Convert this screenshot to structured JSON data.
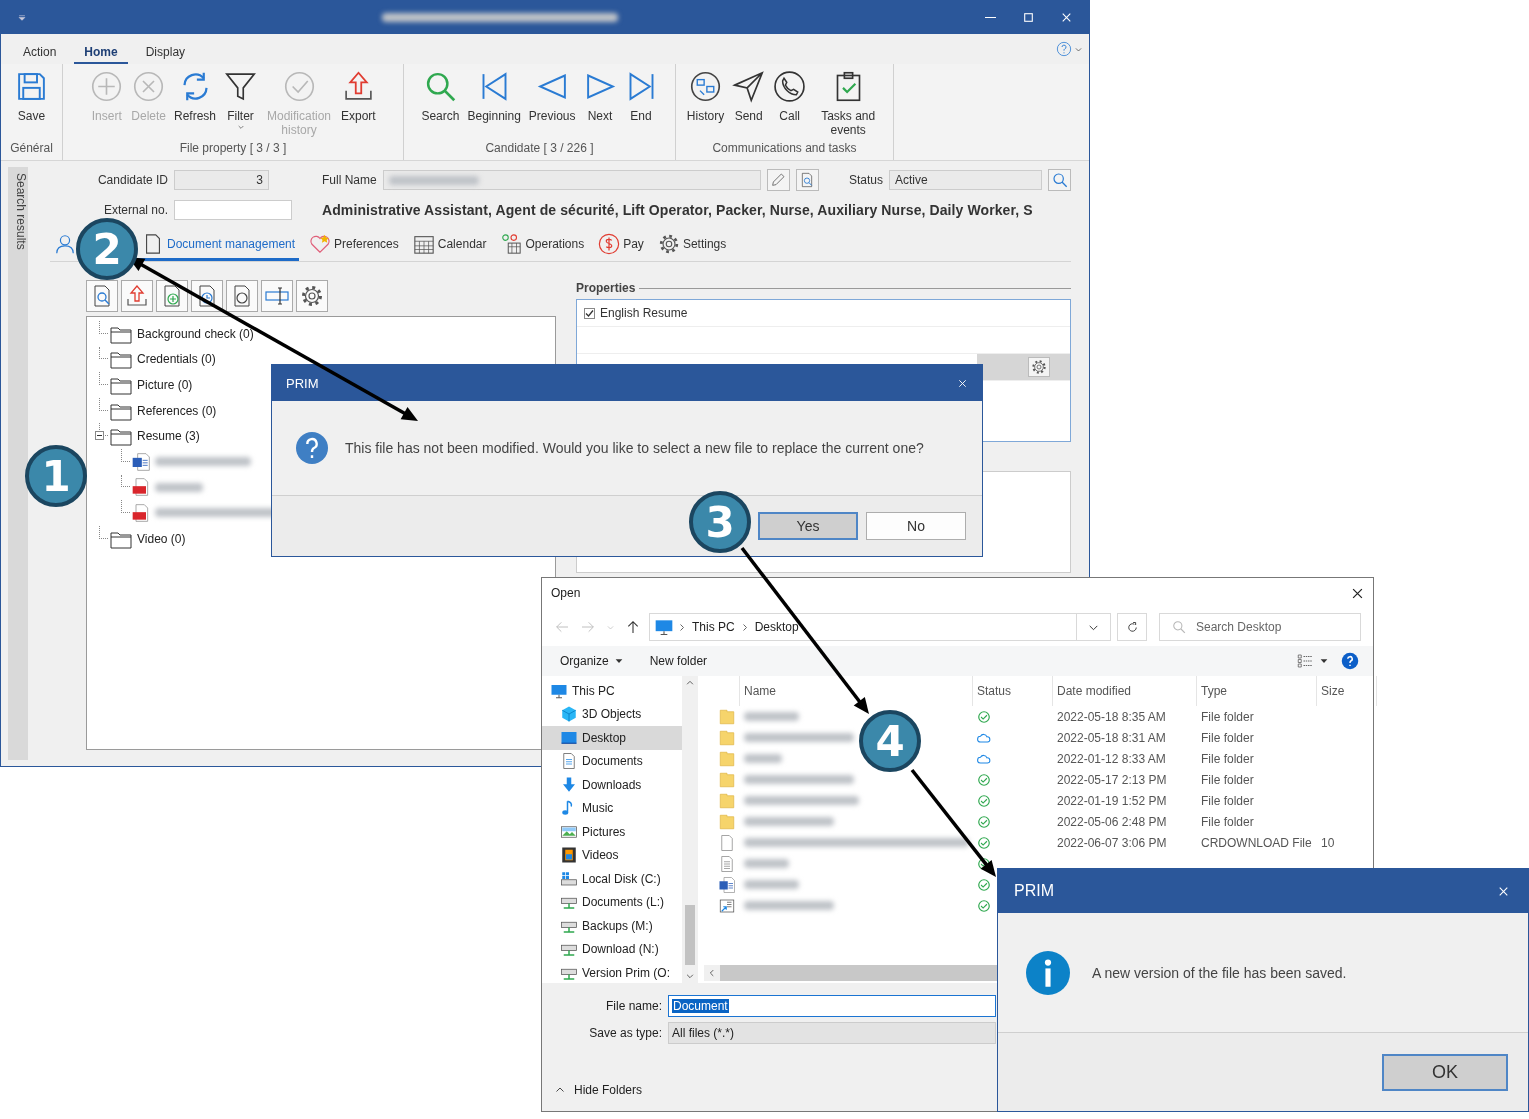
{
  "main_window": {
    "menu_tabs": [
      {
        "label": "Action",
        "selected": false
      },
      {
        "label": "Home",
        "selected": true
      },
      {
        "label": "Display",
        "selected": false
      }
    ],
    "ribbon_groups": [
      {
        "label": "Général",
        "buttons": [
          {
            "label": "Save",
            "kind": "save",
            "disabled": false,
            "dropdown": false
          }
        ]
      },
      {
        "label": "File property [ 3 / 3 ]",
        "buttons": [
          {
            "label": "Insert",
            "kind": "insert",
            "disabled": true,
            "dropdown": false
          },
          {
            "label": "Delete",
            "kind": "delete",
            "disabled": true,
            "dropdown": false
          },
          {
            "label": "Refresh",
            "kind": "refresh",
            "disabled": false,
            "dropdown": false
          },
          {
            "label": "Filter",
            "kind": "filter",
            "disabled": false,
            "dropdown": true
          },
          {
            "label": "Modification history",
            "kind": "modhistory",
            "disabled": true,
            "dropdown": false
          },
          {
            "label": "Export",
            "kind": "export",
            "disabled": false,
            "dropdown": false
          }
        ]
      },
      {
        "label": "Candidate [ 3 / 226 ]",
        "buttons": [
          {
            "label": "Search",
            "kind": "search",
            "disabled": false,
            "dropdown": false
          },
          {
            "label": "Beginning",
            "kind": "first",
            "disabled": false,
            "dropdown": false
          },
          {
            "label": "Previous",
            "kind": "previous",
            "disabled": false,
            "dropdown": false
          },
          {
            "label": "Next",
            "kind": "next",
            "disabled": false,
            "dropdown": false
          },
          {
            "label": "End",
            "kind": "end",
            "disabled": false,
            "dropdown": false
          }
        ]
      },
      {
        "label": "Communications and tasks",
        "buttons": [
          {
            "label": "History",
            "kind": "history",
            "disabled": false,
            "dropdown": false
          },
          {
            "label": "Send",
            "kind": "send",
            "disabled": false,
            "dropdown": false
          },
          {
            "label": "Call",
            "kind": "call",
            "disabled": false,
            "dropdown": false
          },
          {
            "label": "Tasks and events",
            "kind": "tasks",
            "disabled": false,
            "dropdown": false
          }
        ]
      }
    ],
    "side_tab": "Search results",
    "candidate_id": {
      "label": "Candidate ID",
      "value": "3"
    },
    "full_name": {
      "label": "Full Name"
    },
    "status": {
      "label": "Status",
      "value": "Active"
    },
    "external_no": {
      "label": "External no."
    },
    "job_titles": "Administrative Assistant, Agent de sécurité, Lift Operator, Packer, Nurse, Auxiliary Nurse, Daily Worker, S",
    "section_tabs": [
      {
        "kind": "person",
        "selected": false
      },
      {
        "label": "Document management",
        "kind": "document",
        "selected": true
      },
      {
        "label": "Preferences",
        "kind": "preferences",
        "selected": false
      },
      {
        "label": "Calendar",
        "kind": "calendar",
        "selected": false
      },
      {
        "label": "Operations",
        "kind": "operations",
        "selected": false
      },
      {
        "label": "Pay",
        "kind": "pay",
        "selected": false
      },
      {
        "label": "Settings",
        "kind": "settings",
        "selected": false
      }
    ],
    "tree": [
      {
        "label": "Background check (0)",
        "kind": "folder"
      },
      {
        "label": "Credentials (0)",
        "kind": "folder"
      },
      {
        "label": "Picture (0)",
        "kind": "folder"
      },
      {
        "label": "References (0)",
        "kind": "folder"
      },
      {
        "label": "Resume (3)",
        "kind": "folder",
        "children": [
          {
            "kind": "word"
          },
          {
            "kind": "pdf"
          },
          {
            "kind": "pdf"
          }
        ]
      },
      {
        "label": "Video (0)",
        "kind": "folder"
      }
    ],
    "properties": {
      "title": "Properties",
      "items": [
        {
          "label": "English Resume",
          "checked": true
        }
      ]
    }
  },
  "ask_dialog": {
    "title": "PRIM",
    "message": "This file has not been modified. Would you like to select a new file to replace the current one?",
    "buttons": [
      {
        "label": "Yes",
        "default": true
      },
      {
        "label": "No",
        "default": false
      }
    ]
  },
  "open_dialog": {
    "title": "Open",
    "path": [
      "This PC",
      "Desktop"
    ],
    "search": {
      "placeholder": "Search Desktop"
    },
    "toolbar": [
      "Organize",
      "New folder"
    ],
    "nav": [
      {
        "label": "This PC",
        "kind": "pc",
        "selected": false,
        "children": [
          {
            "label": "3D Objects",
            "kind": "objects",
            "selected": false
          },
          {
            "label": "Desktop",
            "kind": "desktop",
            "selected": true
          },
          {
            "label": "Documents",
            "kind": "documents",
            "selected": false
          },
          {
            "label": "Downloads",
            "kind": "downloads",
            "selected": false
          },
          {
            "label": "Music",
            "kind": "music",
            "selected": false
          },
          {
            "label": "Pictures",
            "kind": "pictures",
            "selected": false
          },
          {
            "label": "Videos",
            "kind": "videos",
            "selected": false
          },
          {
            "label": "Local Disk (C:)",
            "kind": "disk",
            "selected": false
          },
          {
            "label": "Documents (L:)",
            "kind": "network",
            "selected": false
          },
          {
            "label": "Backups (M:)",
            "kind": "network",
            "selected": false
          },
          {
            "label": "Download (N:)",
            "kind": "network",
            "selected": false
          },
          {
            "label": "Version Prim (O:",
            "kind": "network",
            "selected": false
          }
        ]
      }
    ],
    "columns": [
      "Name",
      "Status",
      "Date modified",
      "Type",
      "Size"
    ],
    "rows": [
      {
        "kind": "folder",
        "synced": true,
        "date": "2022-05-18 8:35 AM",
        "type": "File folder"
      },
      {
        "kind": "folder",
        "synced": false,
        "date": "2022-05-18 8:31 AM",
        "type": "File folder"
      },
      {
        "kind": "folder",
        "synced": false,
        "date": "2022-01-12 8:33 AM",
        "type": "File folder"
      },
      {
        "kind": "folder",
        "synced": true,
        "date": "2022-05-17 2:13 PM",
        "type": "File folder"
      },
      {
        "kind": "folder",
        "synced": true,
        "date": "2022-01-19 1:52 PM",
        "type": "File folder"
      },
      {
        "kind": "folder",
        "synced": true,
        "date": "2022-05-06 2:48 PM",
        "type": "File folder"
      },
      {
        "kind": "file",
        "synced": true,
        "date": "2022-06-07 3:06 PM",
        "type": "CRDOWNLOAD File",
        "size": "10"
      },
      {
        "kind": "text",
        "synced": true
      },
      {
        "kind": "word",
        "synced": true
      },
      {
        "kind": "shortcut",
        "synced": true
      }
    ],
    "file_name": {
      "label": "File name:",
      "value": "Document",
      "selected": true
    },
    "file_type": {
      "label": "Save as type:",
      "value": "All files (*.*)"
    },
    "hide_folders": "Hide Folders"
  },
  "info_dialog": {
    "title": "PRIM",
    "message": "A new version of the file has been saved.",
    "buttons": [
      {
        "label": "OK",
        "default": true
      }
    ]
  },
  "callouts": [
    {
      "number": "1"
    },
    {
      "number": "2"
    },
    {
      "number": "3"
    },
    {
      "number": "4"
    }
  ]
}
